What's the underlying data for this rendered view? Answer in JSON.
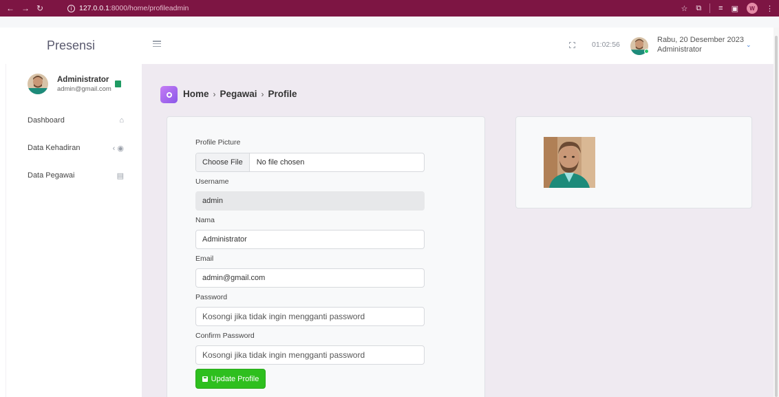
{
  "browser": {
    "url_host": "127.0.0.1",
    "url_path": ":8000/home/profileadmin",
    "profile_initial": "W"
  },
  "app": {
    "brand": "Presensi"
  },
  "sidebar": {
    "user_name": "Administrator",
    "user_email": "admin@gmail.com",
    "items": [
      {
        "label": "Dashboard",
        "icon": "home-icon"
      },
      {
        "label": "Data Kehadiran",
        "icon": "chevron-left-icon"
      },
      {
        "label": "Data Pegawai",
        "icon": "id-card-icon"
      }
    ]
  },
  "topbar": {
    "time": "01:02:56",
    "date": "Rabu, 20 Desember 2023",
    "role": "Administrator"
  },
  "breadcrumb": [
    "Home",
    "Pegawai",
    "Profile"
  ],
  "form": {
    "profile_picture_label": "Profile Picture",
    "choose_file": "Choose File",
    "no_file": "No file chosen",
    "username_label": "Username",
    "username_value": "admin",
    "nama_label": "Nama",
    "nama_value": "Administrator",
    "email_label": "Email",
    "email_value": "admin@gmail.com",
    "password_label": "Password",
    "password_placeholder": "Kosongi jika tidak ingin mengganti password",
    "confirm_label": "Confirm Password",
    "confirm_placeholder": "Kosongi jika tidak ingin mengganti password",
    "submit_label": "Update Profile"
  },
  "colors": {
    "browser_bar": "#7d1543",
    "accent_gradient": "#8a58e8",
    "submit": "#2ebf1e"
  }
}
